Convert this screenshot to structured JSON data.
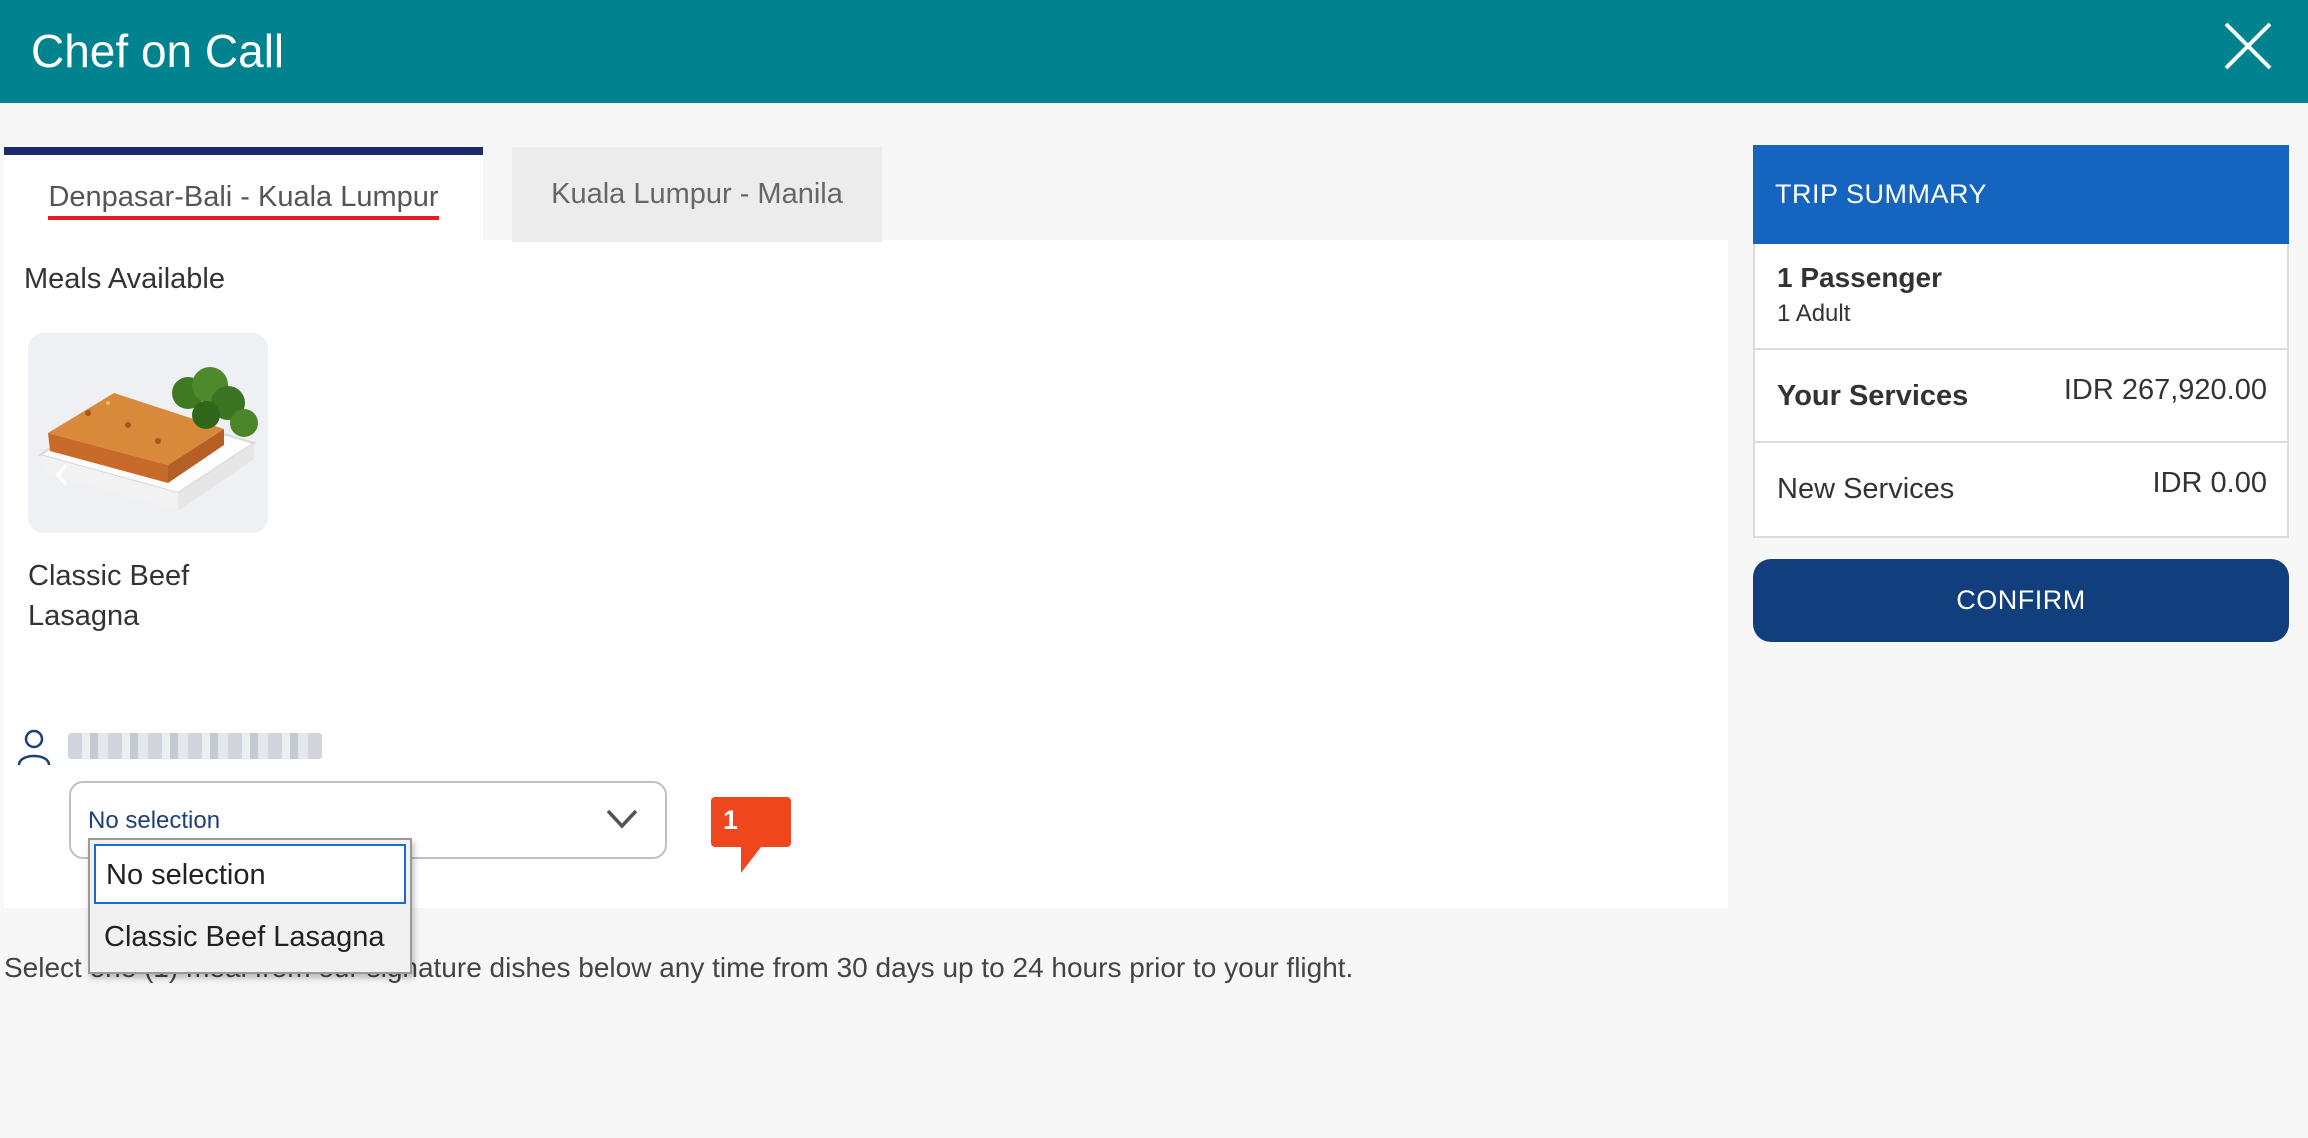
{
  "header": {
    "title": "Chef on Call"
  },
  "tabs": [
    {
      "label": "Denpasar-Bali - Kuala Lumpur"
    },
    {
      "label": "Kuala Lumpur - Manila"
    }
  ],
  "meals": {
    "title": "Meals Available",
    "items": [
      {
        "name": "Classic Beef Lasagna"
      }
    ]
  },
  "passenger": {
    "select_value": "No selection",
    "badge_count": "1",
    "options": [
      "No selection",
      "Classic Beef Lasagna"
    ]
  },
  "info_text": "Select one (1) meal from our signature dishes below any time from 30 days up to 24 hours prior to your flight.",
  "summary": {
    "title": "TRIP SUMMARY",
    "passengers": "1 Passenger",
    "passenger_detail": "1 Adult",
    "your_services_label": "Your Services",
    "your_services_amount": "IDR 267,920.00",
    "new_services_label": "New Services",
    "new_services_amount": "IDR 0.00",
    "confirm_label": "CONFIRM"
  },
  "colors": {
    "header": "#00838f",
    "summary_header": "#1565c0",
    "confirm": "#113f7d",
    "badge": "#f0461e",
    "tab_underline": "#e31b23"
  }
}
